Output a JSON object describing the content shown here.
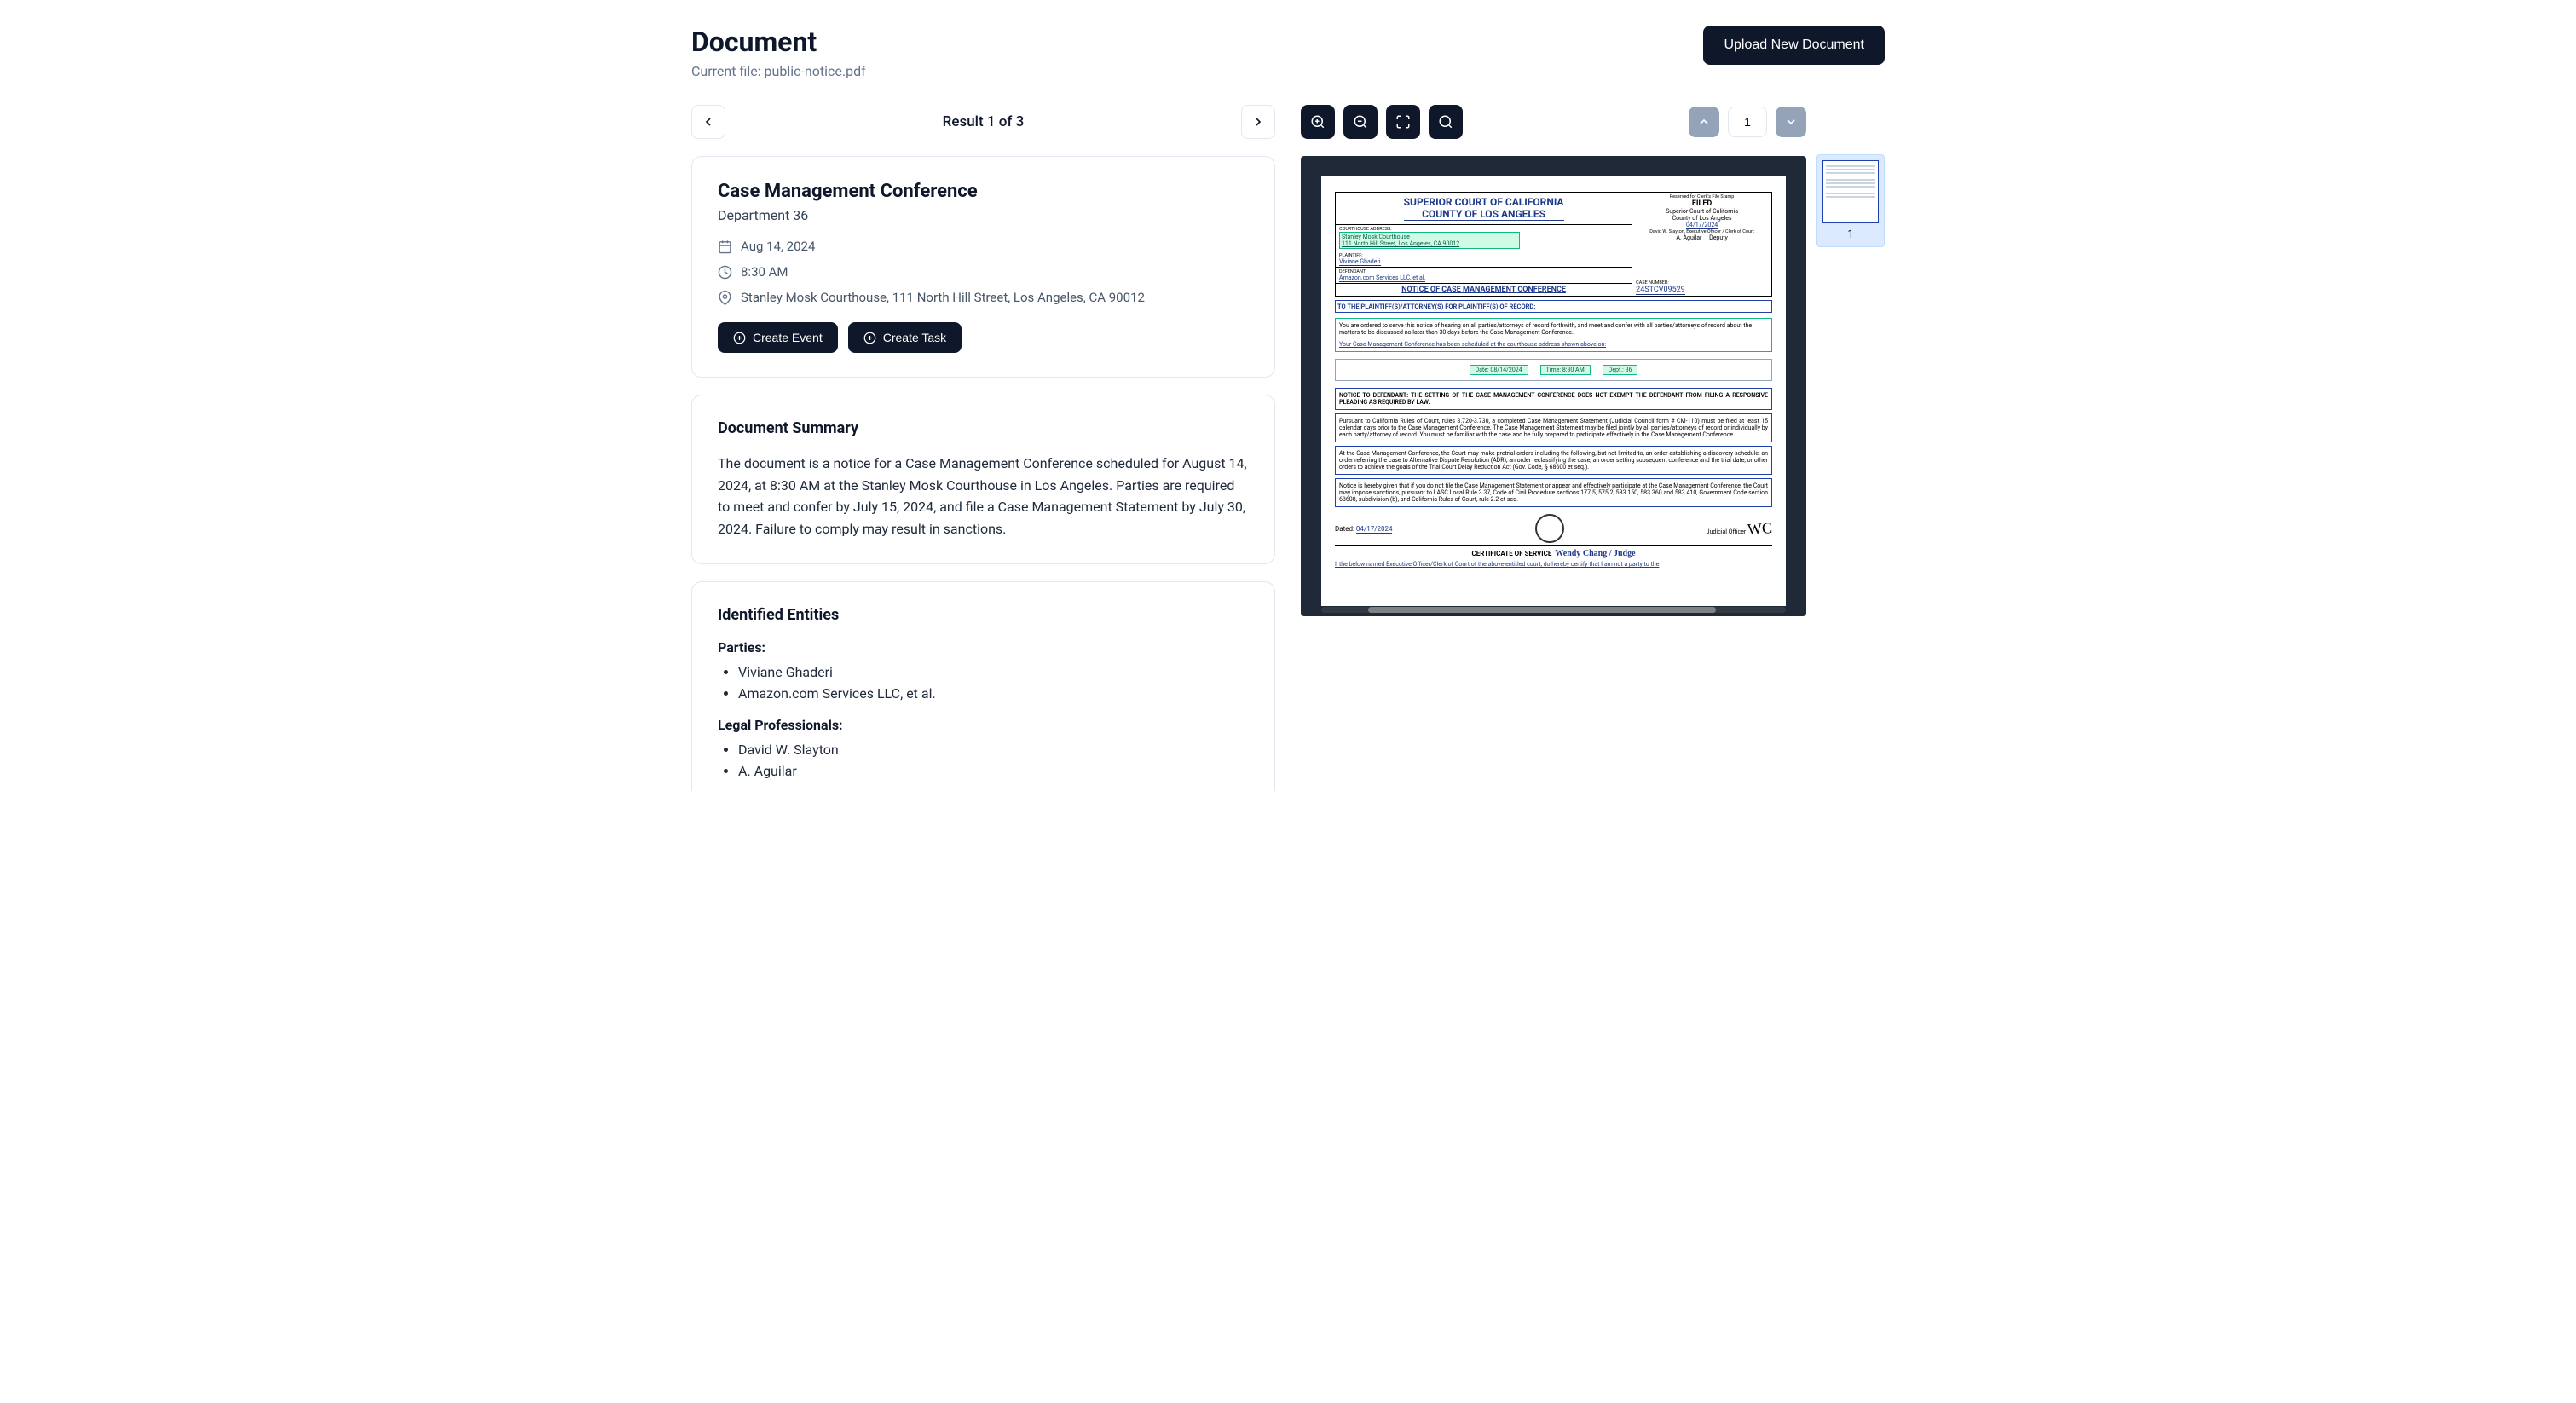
{
  "header": {
    "title": "Document",
    "current_file_prefix": "Current file: ",
    "current_file_name": "public-notice.pdf",
    "upload_button": "Upload New Document"
  },
  "results_nav": {
    "label": "Result 1 of 3"
  },
  "event_card": {
    "title": "Case Management Conference",
    "subtitle": "Department 36",
    "date": "Aug 14, 2024",
    "time": "8:30 AM",
    "location": "Stanley Mosk Courthouse, 111 North Hill Street, Los Angeles, CA 90012",
    "create_event_label": "Create Event",
    "create_task_label": "Create Task"
  },
  "summary_card": {
    "title": "Document Summary",
    "body": "The document is a notice for a Case Management Conference scheduled for August 14, 2024, at 8:30 AM at the Stanley Mosk Courthouse in Los Angeles. Parties are required to meet and confer by July 15, 2024, and file a Case Management Statement by July 30, 2024. Failure to comply may result in sanctions."
  },
  "entities_card": {
    "title": "Identified Entities",
    "groups": [
      {
        "label": "Parties:",
        "items": [
          "Viviane Ghaderi",
          "Amazon.com Services LLC, et al."
        ]
      },
      {
        "label": "Legal Professionals:",
        "items": [
          "David W. Slayton",
          "A. Aguilar"
        ]
      }
    ]
  },
  "viewer": {
    "current_page": "1",
    "thumbnail_label": "1"
  },
  "doc_content": {
    "court_line1": "SUPERIOR COURT OF CALIFORNIA",
    "court_line2": "COUNTY OF LOS ANGELES",
    "filed_reserved": "Reserved for Clerk's File Stamp",
    "filed_label": "FILED",
    "filed_court": "Superior Court of California",
    "filed_county": "County of Los Angeles",
    "filed_date": "04/17/2024",
    "filed_officer": "David W. Slayton, Executive Officer / Clerk of Court",
    "deputy_name": "A. Aguilar",
    "deputy_label": "Deputy",
    "courthouse_addr_label": "COURTHOUSE ADDRESS:",
    "courthouse_name": "Stanley Mosk Courthouse",
    "courthouse_addr": "111 North Hill Street, Los Angeles, CA 90012",
    "plaintiff_label": "PLAINTIFF:",
    "plaintiff": "Viviane Ghaderi",
    "defendant_label": "DEFENDANT:",
    "defendant": "Amazon.com Services LLC, et al.",
    "notice_title": "NOTICE OF CASE MANAGEMENT CONFERENCE",
    "case_no_label": "CASE NUMBER:",
    "case_no": "24STCV09529",
    "addressee": "TO THE PLAINTIFF(S)/ATTORNEY(S) FOR PLAINTIFF(S) OF RECORD:",
    "order_text": "You are ordered to serve this notice of hearing on all parties/attorneys of record forthwith, and meet and confer with all parties/attorneys of record about the matters to be discussed no later than 30 days before the Case Management Conference.",
    "sched_text": "Your Case Management Conference has been scheduled at the courthouse address shown above on:",
    "detail_date_label": "Date:",
    "detail_date": "08/14/2024",
    "detail_time_label": "Time:",
    "detail_time": "8:30 AM",
    "detail_dept_label": "Dept.:",
    "detail_dept": "36",
    "notice_defendant": "NOTICE TO DEFENDANT:    THE SETTING OF THE CASE MANAGEMENT CONFERENCE DOES NOT EXEMPT THE DEFENDANT FROM FILING A RESPONSIVE PLEADING AS REQUIRED BY LAW.",
    "para1": "Pursuant to California Rules of Court, rules 3.720-3.730, a completed Case Management Statement (Judicial Council form # CM-110) must be filed at least 15 calendar days prior to the Case Management Conference. The Case Management Statement may be filed jointly by all parties/attorneys of record or individually by each party/attorney of record. You must be familiar with the case and be fully prepared to participate effectively in the Case Management Conference.",
    "para2": "At the Case Management Conference, the Court may make pretrial orders including the following, but not limited to, an order establishing a discovery schedule; an order referring the case to Alternative Dispute Resolution (ADR); an order reclassifying the case; an order setting subsequent conference and the trial date; or other orders to achieve the goals of the Trial Court Delay Reduction Act (Gov. Code, § 68600 et seq.).",
    "para3": "Notice is hereby given that if you do not file the Case Management Statement or appear and effectively participate at the Case Management Conference, the Court may impose sanctions, pursuant to LASC Local Rule 3.37, Code of Civil Procedure sections 177.5, 575.2, 583.150, 583.360 and 583.410, Government Code section 68608, subdivision (b), and California Rules of Court, rule 2.2 et seq.",
    "sig_dated_label": "Dated:",
    "sig_date": "04/17/2024",
    "judicial_officer": "Judicial Officer",
    "cert_title": "CERTIFICATE OF SERVICE",
    "judge": "Wendy Chang / Judge",
    "cert_body": "I, the below named Executive Officer/Clerk of Court of the above-entitled court, do hereby certify that I am not a party to the"
  }
}
